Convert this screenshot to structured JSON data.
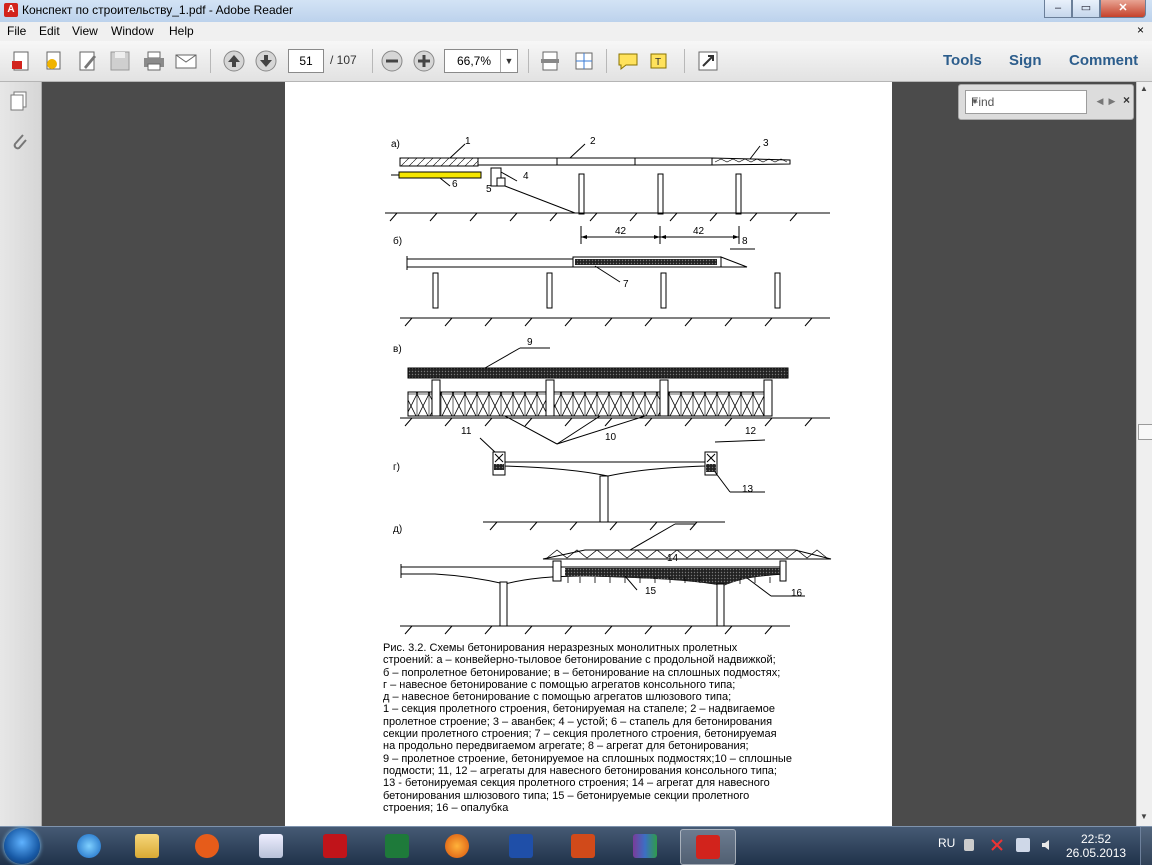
{
  "window": {
    "title": "Конспект по строительству_1.pdf - Adobe Reader",
    "minimize": "–",
    "maximize": "▭",
    "close": "✕"
  },
  "menu": {
    "items": [
      "File",
      "Edit",
      "View",
      "Window",
      "Help"
    ],
    "close": "×"
  },
  "toolbar": {
    "page_current": "51",
    "page_total": "/ 107",
    "zoom": "66,7%",
    "tools": "Tools",
    "sign": "Sign",
    "comment": "Comment"
  },
  "find": {
    "placeholder": "Find",
    "close": "×"
  },
  "figure": {
    "panel_labels": [
      "а)",
      "б)",
      "в)",
      "г)",
      "д)"
    ],
    "callouts": [
      "1",
      "2",
      "3",
      "4",
      "5",
      "6",
      "7",
      "8",
      "9",
      "10",
      "11",
      "12",
      "13",
      "14",
      "15",
      "16"
    ],
    "dimension": "42"
  },
  "caption": {
    "lines": [
      "Рис. 3.2. Схемы бетонирования неразрезных монолитных пролетных",
      "строений:   а – конвейерно-тыловое бетонирование с продольной надвижкой;",
      "б – попролетное бетонирование; в – бетонирование на сплошных подмостях;",
      "г – навесное бетонирование с помощью агрегатов консольного типа;",
      "д – навесное бетонирование с помощью агрегатов шлюзового типа;",
      "1 – секция пролетного строения, бетонируемая на стапеле; 2 – надвигаемое",
      "пролетное строение; 3 – аванбек; 4 – устой; 6 – стапель для бетонирования",
      "секции пролетного строения; 7 – секция пролетного строения, бетонируемая",
      "на продольно передвигаемом агрегате; 8 – агрегат для бетонирования;",
      "9 – пролетное строение, бетонируемое на сплошных подмостях;10 – сплошные",
      "подмости; 11, 12 – агрегаты для навесного бетонирования консольного типа;",
      "13 - бетонируемая секция пролетного строения; 14 – агрегат для навесного",
      "бетонирования шлюзового типа; 15 – бетонируемые секции пролетного",
      "строения; 16 – опалубка"
    ]
  },
  "taskbar": {
    "language": "RU",
    "time": "22:52",
    "date": "26.05.2013"
  },
  "colors": {
    "stapel_yellow": "#f5e600",
    "reader_red": "#d2231c",
    "link_blue": "#2c5d8c"
  }
}
